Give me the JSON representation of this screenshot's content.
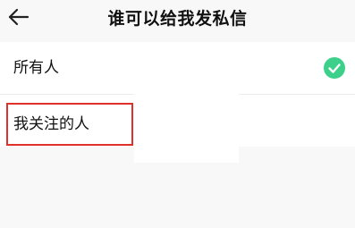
{
  "header": {
    "title": "谁可以给我发私信",
    "back_icon": "arrow-left-icon"
  },
  "options": [
    {
      "label": "所有人",
      "selected": true,
      "icon": "checkmark-circle-icon",
      "icon_color": "#3dd08a"
    },
    {
      "label": "我关注的人",
      "selected": false
    }
  ],
  "annotation": {
    "highlight_color": "#e0302c"
  }
}
